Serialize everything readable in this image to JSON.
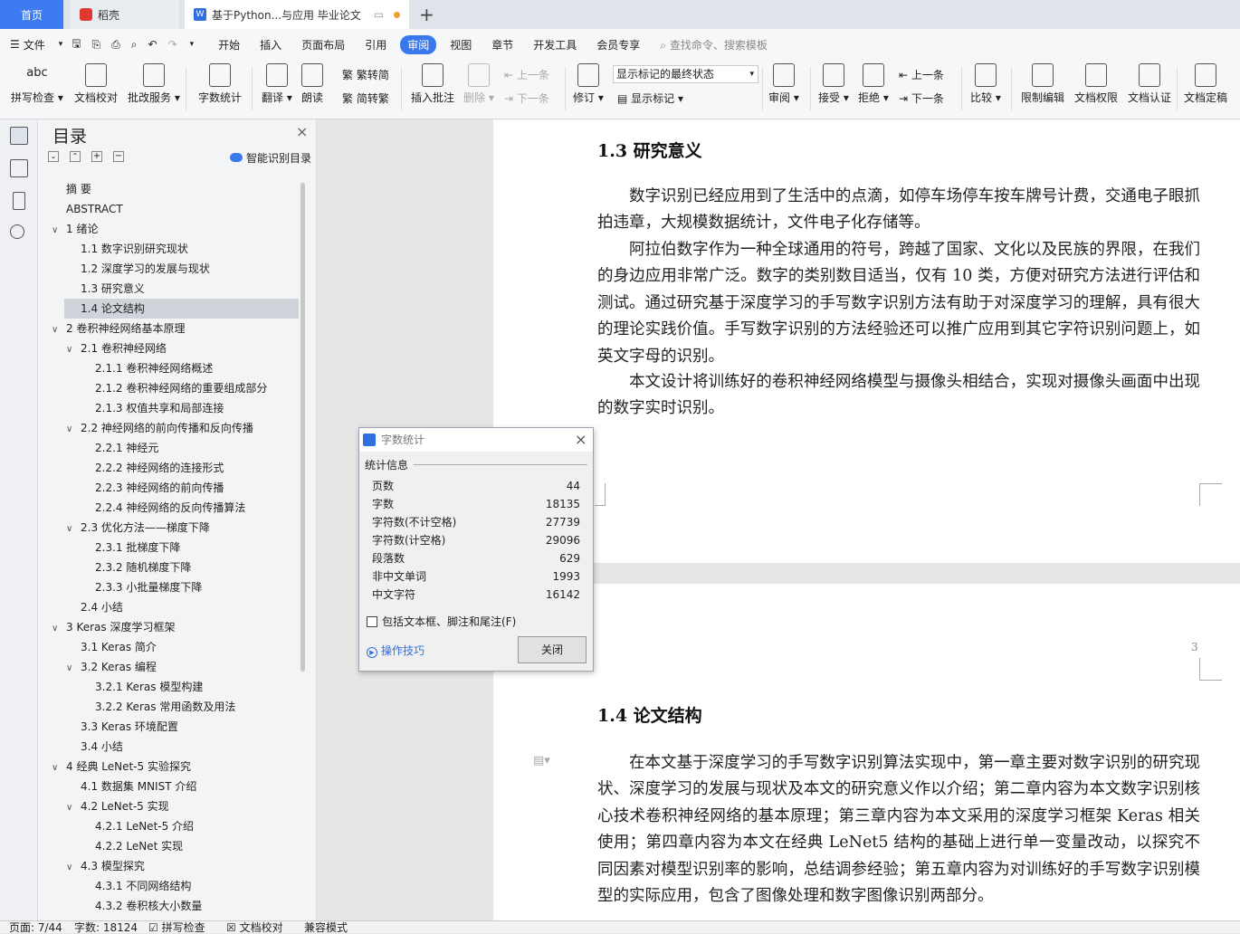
{
  "tabs": {
    "home": "首页",
    "daoke": "稻壳",
    "doc": "基于Python...与应用 毕业论文"
  },
  "menu": {
    "file": "文件",
    "items": [
      "开始",
      "插入",
      "页面布局",
      "引用",
      "审阅",
      "视图",
      "章节",
      "开发工具",
      "会员专享"
    ],
    "active": "审阅",
    "search": "查找命令、搜索模板"
  },
  "ribbon": {
    "spell": "拼写检查",
    "doccheck": "文档校对",
    "annot_service": "批改服务",
    "wordcount": "字数统计",
    "translate": "翻译",
    "read": "朗读",
    "trad": "繁转简",
    "simp": "简转繁",
    "insert_comment": "插入批注",
    "delete": "删除",
    "prev": "上一条",
    "next": "下一条",
    "revise": "修订",
    "markup_select": "显示标记的最终状态",
    "show_markup": "显示标记",
    "review": "审阅",
    "accept": "接受",
    "reject": "拒绝",
    "prev2": "上一条",
    "next2": "下一条",
    "compare": "比较",
    "restrict": "限制编辑",
    "perm": "文档权限",
    "auth": "文档认证",
    "final": "文档定稿"
  },
  "toc": {
    "title": "目录",
    "smart": "智能识别目录",
    "items": [
      {
        "t": "摘  要",
        "lvl": 0,
        "chev": false
      },
      {
        "t": "ABSTRACT",
        "lvl": 0,
        "chev": false
      },
      {
        "t": "1  绪论",
        "lvl": 0,
        "chev": true
      },
      {
        "t": "1.1  数字识别研究现状",
        "lvl": 1,
        "chev": false
      },
      {
        "t": "1.2  深度学习的发展与现状",
        "lvl": 1,
        "chev": false
      },
      {
        "t": "1.3  研究意义",
        "lvl": 1,
        "chev": false
      },
      {
        "t": "1.4  论文结构",
        "lvl": 1,
        "chev": false,
        "sel": true
      },
      {
        "t": "2  卷积神经网络基本原理",
        "lvl": 0,
        "chev": true
      },
      {
        "t": "2.1  卷积神经网络",
        "lvl": 1,
        "chev": true
      },
      {
        "t": "2.1.1  卷积神经网络概述",
        "lvl": 2,
        "chev": false
      },
      {
        "t": "2.1.2  卷积神经网络的重要组成部分",
        "lvl": 2,
        "chev": false
      },
      {
        "t": "2.1.3  权值共享和局部连接",
        "lvl": 2,
        "chev": false
      },
      {
        "t": "2.2  神经网络的前向传播和反向传播",
        "lvl": 1,
        "chev": true
      },
      {
        "t": "2.2.1  神经元",
        "lvl": 2,
        "chev": false
      },
      {
        "t": "2.2.2  神经网络的连接形式",
        "lvl": 2,
        "chev": false
      },
      {
        "t": "2.2.3  神经网络的前向传播",
        "lvl": 2,
        "chev": false
      },
      {
        "t": "2.2.4  神经网络的反向传播算法",
        "lvl": 2,
        "chev": false
      },
      {
        "t": "2.3  优化方法——梯度下降",
        "lvl": 1,
        "chev": true
      },
      {
        "t": "2.3.1  批梯度下降",
        "lvl": 2,
        "chev": false
      },
      {
        "t": "2.3.2  随机梯度下降",
        "lvl": 2,
        "chev": false
      },
      {
        "t": "2.3.3  小批量梯度下降",
        "lvl": 2,
        "chev": false
      },
      {
        "t": "2.4  小结",
        "lvl": 1,
        "chev": false
      },
      {
        "t": "3 Keras 深度学习框架",
        "lvl": 0,
        "chev": true
      },
      {
        "t": "3.1 Keras 简介",
        "lvl": 1,
        "chev": false
      },
      {
        "t": "3.2 Keras 编程",
        "lvl": 1,
        "chev": true
      },
      {
        "t": "3.2.1 Keras 模型构建",
        "lvl": 2,
        "chev": false
      },
      {
        "t": "3.2.2 Keras 常用函数及用法",
        "lvl": 2,
        "chev": false
      },
      {
        "t": "3.3 Keras 环境配置",
        "lvl": 1,
        "chev": false
      },
      {
        "t": "3.4  小结",
        "lvl": 1,
        "chev": false
      },
      {
        "t": "4  经典 LeNet-5 实验探究",
        "lvl": 0,
        "chev": true
      },
      {
        "t": "4.1  数据集 MNIST 介绍",
        "lvl": 1,
        "chev": false
      },
      {
        "t": "4.2 LeNet-5 实现",
        "lvl": 1,
        "chev": true
      },
      {
        "t": "4.2.1 LeNet-5 介绍",
        "lvl": 2,
        "chev": false
      },
      {
        "t": "4.2.2 LeNet 实现",
        "lvl": 2,
        "chev": false
      },
      {
        "t": "4.3  模型探究",
        "lvl": 1,
        "chev": true
      },
      {
        "t": "4.3.1  不同网络结构",
        "lvl": 2,
        "chev": false
      },
      {
        "t": "4.3.2  卷积核大小数量",
        "lvl": 2,
        "chev": false
      }
    ]
  },
  "doc": {
    "h13": "1.3  研究意义",
    "p1": "数字识别已经应用到了生活中的点滴，如停车场停车按车牌号计费，交通电子眼抓拍违章，大规模数据统计，文件电子化存储等。",
    "p2": "阿拉伯数字作为一种全球通用的符号，跨越了国家、文化以及民族的界限，在我们的身边应用非常广泛。数字的类别数目适当，仅有 10 类，方便对研究方法进行评估和测试。通过研究基于深度学习的手写数字识别方法有助于对深度学习的理解，具有很大的理论实践价值。手写数字识别的方法经验还可以推广应用到其它字符识别问题上，如英文字母的识别。",
    "p3": "本文设计将训练好的卷积神经网络模型与摄像头相结合，实现对摄像头画面中出现的数字实时识别。",
    "page_num": "3",
    "h14": "1.4  论文结构",
    "p4": "在本文基于深度学习的手写数字识别算法实现中，第一章主要对数字识别的研究现状、深度学习的发展与现状及本文的研究意义作以介绍；第二章内容为本文数字识别核心技术卷积神经网络的基本原理；第三章内容为本文采用的深度学习框架 Keras 相关使用；第四章内容为本文在经典 LeNet5 结构的基础上进行单一变量改动，以探究不同因素对模型识别率的影响，总结调参经验；第五章内容为对训练好的手写数字识别模型的实际应用，包含了图像处理和数字图像识别两部分。"
  },
  "dialog": {
    "title": "字数统计",
    "section": "统计信息",
    "stats": [
      {
        "k": "页数",
        "v": "44"
      },
      {
        "k": "字数",
        "v": "18135"
      },
      {
        "k": "字符数(不计空格)",
        "v": "27739"
      },
      {
        "k": "字符数(计空格)",
        "v": "29096"
      },
      {
        "k": "段落数",
        "v": "629"
      },
      {
        "k": "非中文单词",
        "v": "1993"
      },
      {
        "k": "中文字符",
        "v": "16142"
      }
    ],
    "checkbox": "包括文本框、脚注和尾注(F)",
    "tips": "操作技巧",
    "close": "关闭"
  },
  "status": {
    "page": "页面: 7/44",
    "words": "字数: 18124",
    "spell": "拼写检查",
    "proof": "文档校对",
    "compat": "兼容模式"
  }
}
